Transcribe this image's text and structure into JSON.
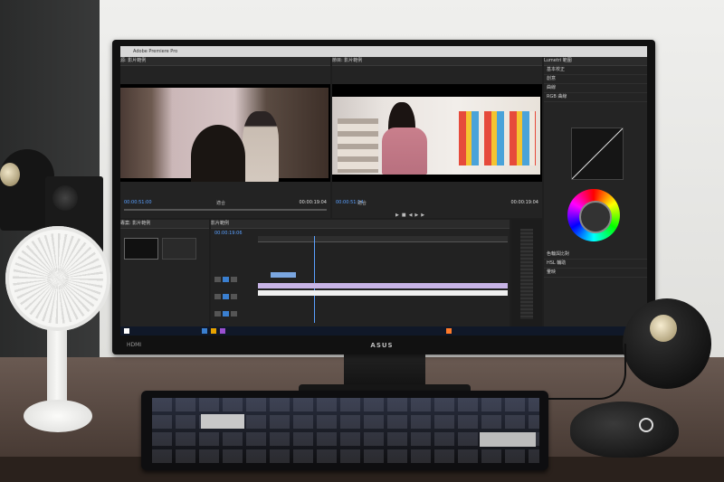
{
  "monitor": {
    "brand": "ASUS",
    "hdmi_label": "HDMI"
  },
  "app": {
    "window_title": "Adobe Premiere Pro",
    "source_panel_label": "源: 影片範例",
    "program_panel_label": "節目: 影片範例",
    "effects_panel_label": "Lumetri 範圍",
    "project_panel_label": "專案: 影片範例",
    "timeline_panel_label": "影片範例",
    "source_timecode_left": "00:00:51:00",
    "source_timecode_right": "00:00:19:04",
    "program_timecode_left": "00:00:51:14",
    "program_timecode_right": "00:00:19:04",
    "source_fit": "適合",
    "program_fit": "適合",
    "timeline_timecode": "00:00:19:06",
    "effects_rows": [
      "基本校正",
      "創意",
      "曲線",
      "RGB 曲線",
      "色相飽和度曲線",
      "色輪與比對",
      "HSL 輔助",
      "暈映"
    ]
  },
  "colors": {
    "accent": "#3a7fd0",
    "timecode_blue": "#5aa0ff",
    "panel_bg": "#1e1e1e"
  },
  "icons": [
    "close-icon",
    "minimize-icon",
    "maximize-icon",
    "play-icon",
    "windows-start-icon"
  ]
}
